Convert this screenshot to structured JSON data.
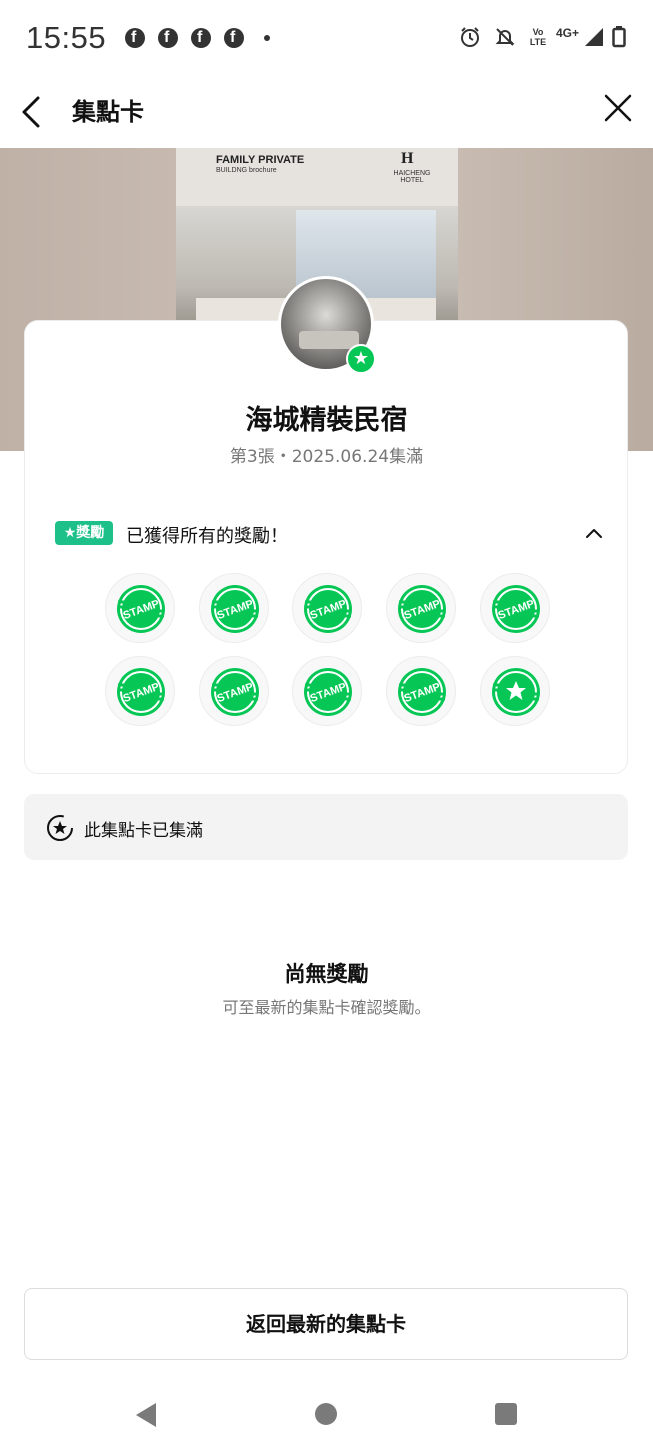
{
  "status_bar": {
    "time": "15:55",
    "notification_icons": [
      "facebook-icon",
      "facebook-icon",
      "facebook-icon",
      "facebook-icon"
    ],
    "right_icons": [
      "alarm-icon",
      "mute-icon",
      "volte-icon",
      "4g-icon",
      "signal-icon",
      "battery-icon"
    ],
    "network_label": "4G+",
    "volte_label_top": "Vo",
    "volte_label_bottom": "LTE"
  },
  "header": {
    "title": "集點卡"
  },
  "banner": {
    "poster_line1": "FAMILY PRIVATE",
    "poster_line2": "BUILDNG brochure",
    "logo_mark": "H",
    "logo_text": "HAICHENG HOTEL"
  },
  "card": {
    "shop_name": "海城精裝民宿",
    "subtitle": "第3張・2025.06.24集滿",
    "reward_tag": "★獎勵",
    "reward_text": "已獲得所有的獎勵！",
    "stamp_label": "STAMP",
    "stamp_count": 10,
    "stamps_collected": 10
  },
  "notice": {
    "text": "此集點卡已集滿"
  },
  "empty": {
    "title": "尚無獎勵",
    "subtitle": "可至最新的集點卡確認獎勵。"
  },
  "buttons": {
    "latest": "返回最新的集點卡"
  },
  "colors": {
    "accent_green": "#06c755",
    "reward_tag": "#1dc089"
  }
}
